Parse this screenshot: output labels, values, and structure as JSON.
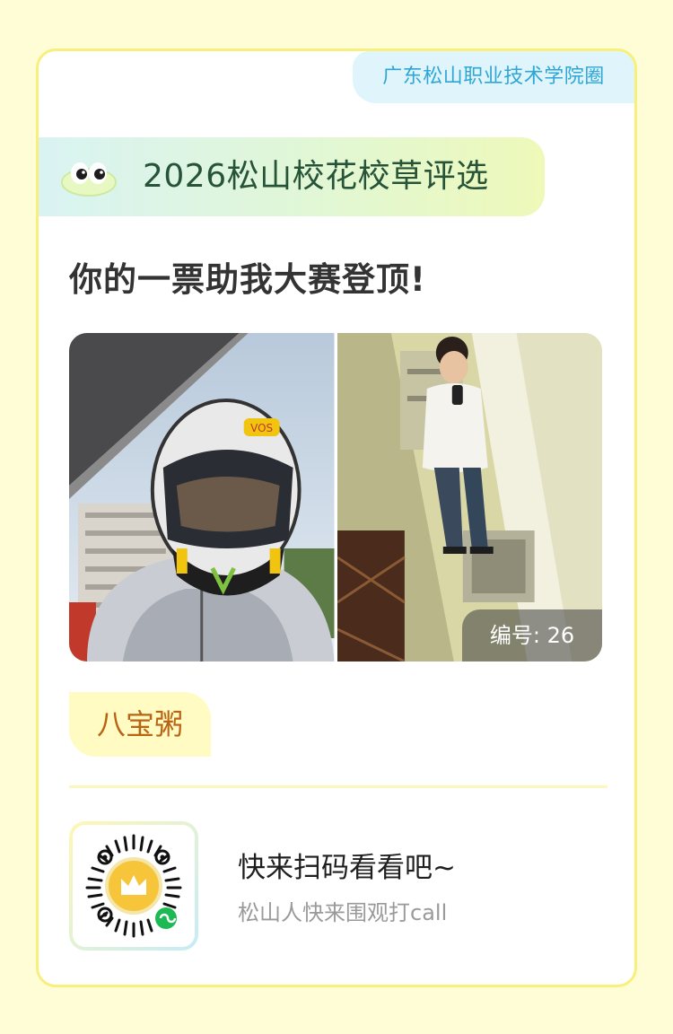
{
  "header": {
    "school_tag": "广东松山职业技术学院圈",
    "title": "2026松山校花校草评选"
  },
  "main": {
    "slogan": "你的一票助我大赛登顶!",
    "photos": [
      {
        "icon": "helmet-selfie-photo"
      },
      {
        "icon": "mirror-selfie-photo"
      }
    ],
    "number_label": "编号: 26",
    "contestant_name": "八宝粥"
  },
  "footer": {
    "cta_title": "快来扫码看看吧~",
    "cta_subtitle": "松山人快来围观打call",
    "qr_icon": "mini-program-qr-code"
  },
  "colors": {
    "page_background": "#fffdd6",
    "card_border": "#f8ef7c",
    "school_tag_text": "#2fa6d6",
    "title_text": "#275339",
    "name_text": "#b86414"
  }
}
